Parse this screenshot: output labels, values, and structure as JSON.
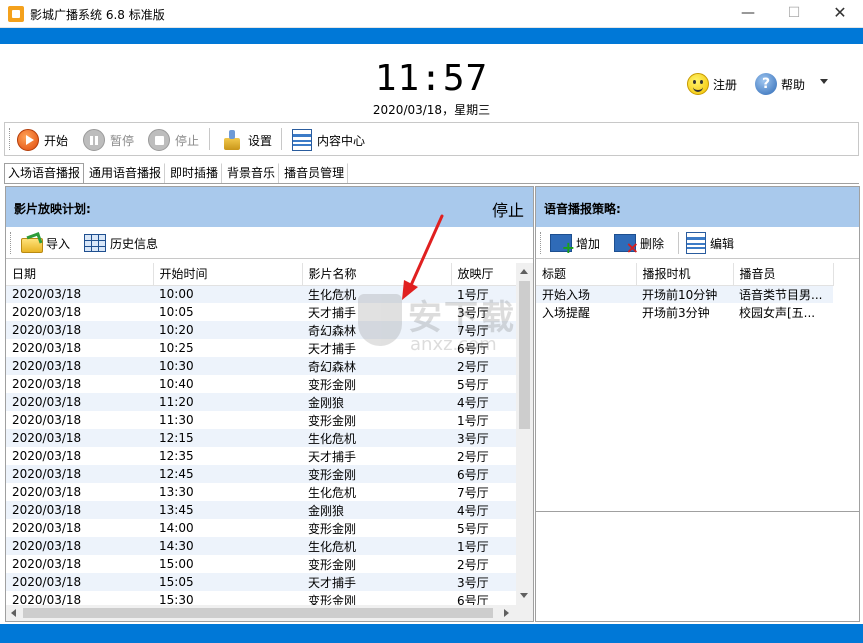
{
  "window": {
    "title": "影城广播系统 6.8 标准版",
    "minimize": "—",
    "maximize": "☐",
    "close": "✕"
  },
  "clock": {
    "time": "11:57",
    "date": "2020/03/18，星期三"
  },
  "header": {
    "register_label": "注册",
    "help_label": "帮助"
  },
  "toolbar": {
    "start_label": "开始",
    "pause_label": "暂停",
    "stop_label": "停止",
    "settings_label": "设置",
    "content_center_label": "内容中心"
  },
  "tabs": [
    {
      "label": "入场语音播报"
    },
    {
      "label": "通用语音播报"
    },
    {
      "label": "即时插播"
    },
    {
      "label": "背景音乐"
    },
    {
      "label": "播音员管理"
    }
  ],
  "schedule_panel": {
    "title": "影片放映计划:",
    "status": "停止",
    "import_label": "导入",
    "history_label": "历史信息",
    "columns": [
      "日期",
      "开始时间",
      "影片名称",
      "放映厅"
    ],
    "rows": [
      [
        "2020/03/18",
        "10:00",
        "生化危机",
        "1号厅"
      ],
      [
        "2020/03/18",
        "10:05",
        "天才捕手",
        "3号厅"
      ],
      [
        "2020/03/18",
        "10:20",
        "奇幻森林",
        "7号厅"
      ],
      [
        "2020/03/18",
        "10:25",
        "天才捕手",
        "6号厅"
      ],
      [
        "2020/03/18",
        "10:30",
        "奇幻森林",
        "2号厅"
      ],
      [
        "2020/03/18",
        "10:40",
        "变形金刚",
        "5号厅"
      ],
      [
        "2020/03/18",
        "11:20",
        "金刚狼",
        "4号厅"
      ],
      [
        "2020/03/18",
        "11:30",
        "变形金刚",
        "1号厅"
      ],
      [
        "2020/03/18",
        "12:15",
        "生化危机",
        "3号厅"
      ],
      [
        "2020/03/18",
        "12:35",
        "天才捕手",
        "2号厅"
      ],
      [
        "2020/03/18",
        "12:45",
        "变形金刚",
        "6号厅"
      ],
      [
        "2020/03/18",
        "13:30",
        "生化危机",
        "7号厅"
      ],
      [
        "2020/03/18",
        "13:45",
        "金刚狼",
        "4号厅"
      ],
      [
        "2020/03/18",
        "14:00",
        "变形金刚",
        "5号厅"
      ],
      [
        "2020/03/18",
        "14:30",
        "生化危机",
        "1号厅"
      ],
      [
        "2020/03/18",
        "15:00",
        "变形金刚",
        "2号厅"
      ],
      [
        "2020/03/18",
        "15:05",
        "天才捕手",
        "3号厅"
      ],
      [
        "2020/03/18",
        "15:30",
        "变形金刚",
        "6号厅"
      ]
    ]
  },
  "strategy_panel": {
    "title": "语音播报策略:",
    "add_label": "增加",
    "delete_label": "删除",
    "edit_label": "编辑",
    "columns": [
      "标题",
      "播报时机",
      "播音员"
    ],
    "rows": [
      [
        "开始入场",
        "开场前10分钟",
        "语音类节目男..."
      ],
      [
        "入场提醒",
        "开场前3分钟",
        "校园女声[五..."
      ]
    ]
  },
  "watermark": {
    "text": "安下载",
    "sub": "anxz.com"
  },
  "colors": {
    "accent_blue": "#0078d7",
    "panel_header": "#a9c9ec",
    "row_stripe": "#edf3fb",
    "annotation_arrow": "#e02020"
  }
}
